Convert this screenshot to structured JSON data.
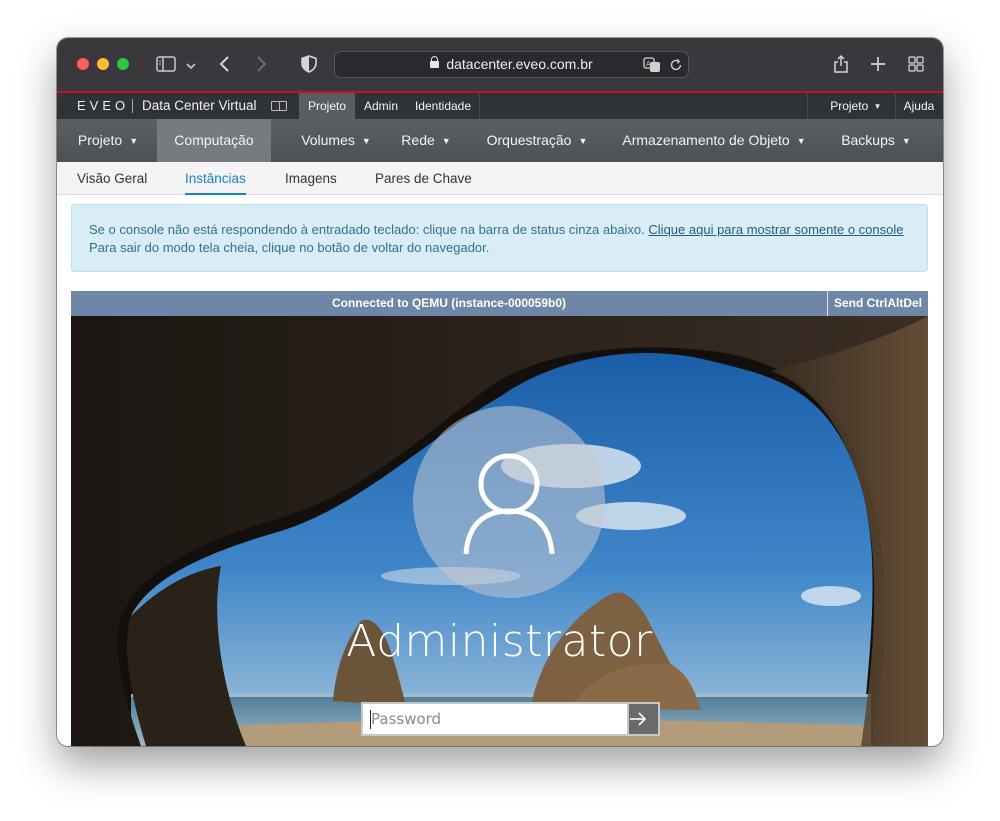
{
  "browser": {
    "url": "datacenter.eveo.com.br",
    "icons": [
      "sidebar-icon",
      "chevron-down-icon",
      "back-icon",
      "forward-icon",
      "shield-icon",
      "lock-icon",
      "translate-icon",
      "reload-icon",
      "share-icon",
      "new-tab-icon",
      "tab-overview-icon"
    ]
  },
  "topbar": {
    "brand": "EVEO",
    "title": "Data Center Virtual",
    "links": [
      "Projeto",
      "Admin",
      "Identidade"
    ],
    "active_link": "Projeto",
    "project_menu": "Projeto",
    "help": "Ajuda"
  },
  "mainnav": {
    "items": [
      "Projeto",
      "Computação",
      "Volumes",
      "Rede",
      "Orquestração",
      "Armazenamento de Objeto",
      "Backups"
    ],
    "active": "Computação"
  },
  "subnav": {
    "items": [
      "Visão Geral",
      "Instâncias",
      "Imagens",
      "Pares de Chave"
    ],
    "active": "Instâncias"
  },
  "alert": {
    "line1": "Se o console não está respondendo à entradado teclado: clique na barra de status cinza abaixo.",
    "link": "Clique aqui para mostrar somente o console",
    "line2": "Para sair do modo tela cheia, clique no botão de voltar do navegador."
  },
  "console": {
    "status": "Connected to QEMU (instance-000059b0)",
    "ctrl_alt_del": "Send CtrlAltDel",
    "username": "Administrator",
    "password_placeholder": "Password"
  },
  "colors": {
    "accent_red": "#c0141b",
    "subnav_active": "#1a83c6",
    "alert_bg": "#d9edf6",
    "console_bar": "#6f87a6"
  }
}
